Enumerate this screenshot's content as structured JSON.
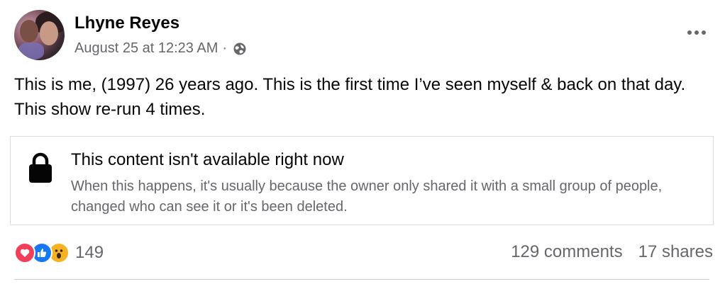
{
  "post": {
    "author": "Lhyne Reyes",
    "timestamp": "August 25 at 12:23 AM",
    "separator": "·",
    "audience_icon": "globe-icon",
    "more_icon": "more-options-icon",
    "text": "This is me, (1997) 26 years ago. This is the first time I’ve seen myself & back on that day. This show re-run 4 times."
  },
  "attachment": {
    "icon": "lock-icon",
    "title": "This content isn't available right now",
    "description": "When this happens, it's usually because the owner only shared it with a small group of people, changed who can see it or it's been deleted."
  },
  "footer": {
    "reactions": [
      "love-reaction-icon",
      "like-reaction-icon",
      "wow-reaction-icon"
    ],
    "reaction_count": "149",
    "comments": "129 comments",
    "shares": "17 shares"
  },
  "colors": {
    "text_primary": "#050505",
    "text_secondary": "#65676b",
    "border": "#dadde1",
    "like_blue": "#1877f2",
    "love_red": "#f33e58",
    "wow_yellow": "#f7b125"
  }
}
